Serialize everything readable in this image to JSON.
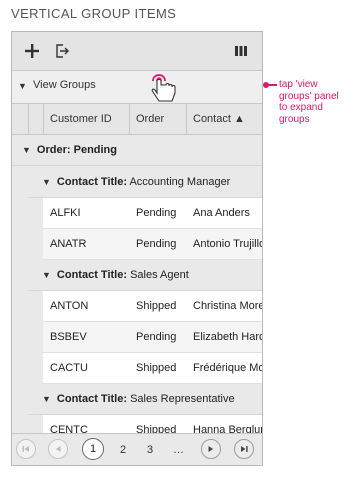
{
  "title": "VERTICAL GROUP ITEMS",
  "toolbar": {
    "add_icon": "plus-icon",
    "export_icon": "export-icon",
    "columns_icon": "columns-icon"
  },
  "group_panel": {
    "label": "View Groups",
    "expand_icon": "triangle-down-icon",
    "hand_icon": "tap-hand-icon"
  },
  "headers": [
    "Customer ID",
    "Order",
    "Contact ▲"
  ],
  "groups": {
    "order": {
      "prefix": "Order:",
      "value": "Pending"
    },
    "accounting": {
      "prefix": "Contact Title:",
      "value": "Accounting Manager"
    },
    "sales_agent": {
      "prefix": "Contact Title:",
      "value": "Sales Agent"
    },
    "sales_rep": {
      "prefix": "Contact Title:",
      "value": "Sales Representative"
    }
  },
  "rows": [
    {
      "id": "ALFKI",
      "order": "Pending",
      "contact": "Ana Anders"
    },
    {
      "id": "ANATR",
      "order": "Pending",
      "contact": "Antonio Trujillo"
    },
    {
      "id": "ANTON",
      "order": "Shipped",
      "contact": "Christina More"
    },
    {
      "id": "BSBEV",
      "order": "Pending",
      "contact": "Elizabeth Hard"
    },
    {
      "id": "CACTU",
      "order": "Shipped",
      "contact": "Frédérique Mo"
    },
    {
      "id": "CENTC",
      "order": "Shipped",
      "contact": "Hanna Berglun"
    }
  ],
  "pager": {
    "pages": [
      "1",
      "2",
      "3",
      "…"
    ],
    "current": "1"
  },
  "callout": {
    "lines": [
      "tap 'view",
      "groups' panel",
      "to expand",
      "groups"
    ],
    "color": "#d6196d"
  }
}
